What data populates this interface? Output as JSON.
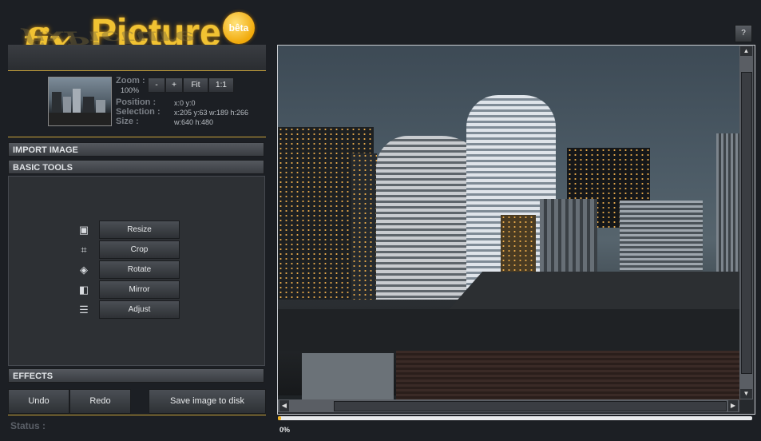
{
  "logo": {
    "word1": "fix",
    "word2": "Picture",
    "badge": "bêta"
  },
  "help_label": "?",
  "zoom": {
    "label": "Zoom :",
    "value": "100%",
    "buttons": [
      "-",
      "+",
      "Fit",
      "1:1"
    ]
  },
  "info": {
    "position_label": "Position :",
    "position_value": "x:0 y:0",
    "selection_label": "Selection :",
    "selection_value": "x:205 y:63 w:189 h:266",
    "size_label": "Size :",
    "size_value": "w:640 h:480"
  },
  "sections": {
    "import": "IMPORT IMAGE",
    "basic": "BASIC TOOLS",
    "effects": "EFFECTS"
  },
  "tools": [
    {
      "label": "Resize",
      "icon": "resize-icon"
    },
    {
      "label": "Crop",
      "icon": "crop-icon"
    },
    {
      "label": "Rotate",
      "icon": "rotate-icon"
    },
    {
      "label": "Mirror",
      "icon": "mirror-icon"
    },
    {
      "label": "Adjust",
      "icon": "adjust-icon"
    }
  ],
  "actions": {
    "undo": "Undo",
    "redo": "Redo",
    "save": "Save image to disk"
  },
  "status_label": "Status :",
  "progress": {
    "text": "0%",
    "fraction": 0
  },
  "colors": {
    "accent": "#f1c232",
    "panel": "#2d3034",
    "background": "#1c1f24"
  }
}
